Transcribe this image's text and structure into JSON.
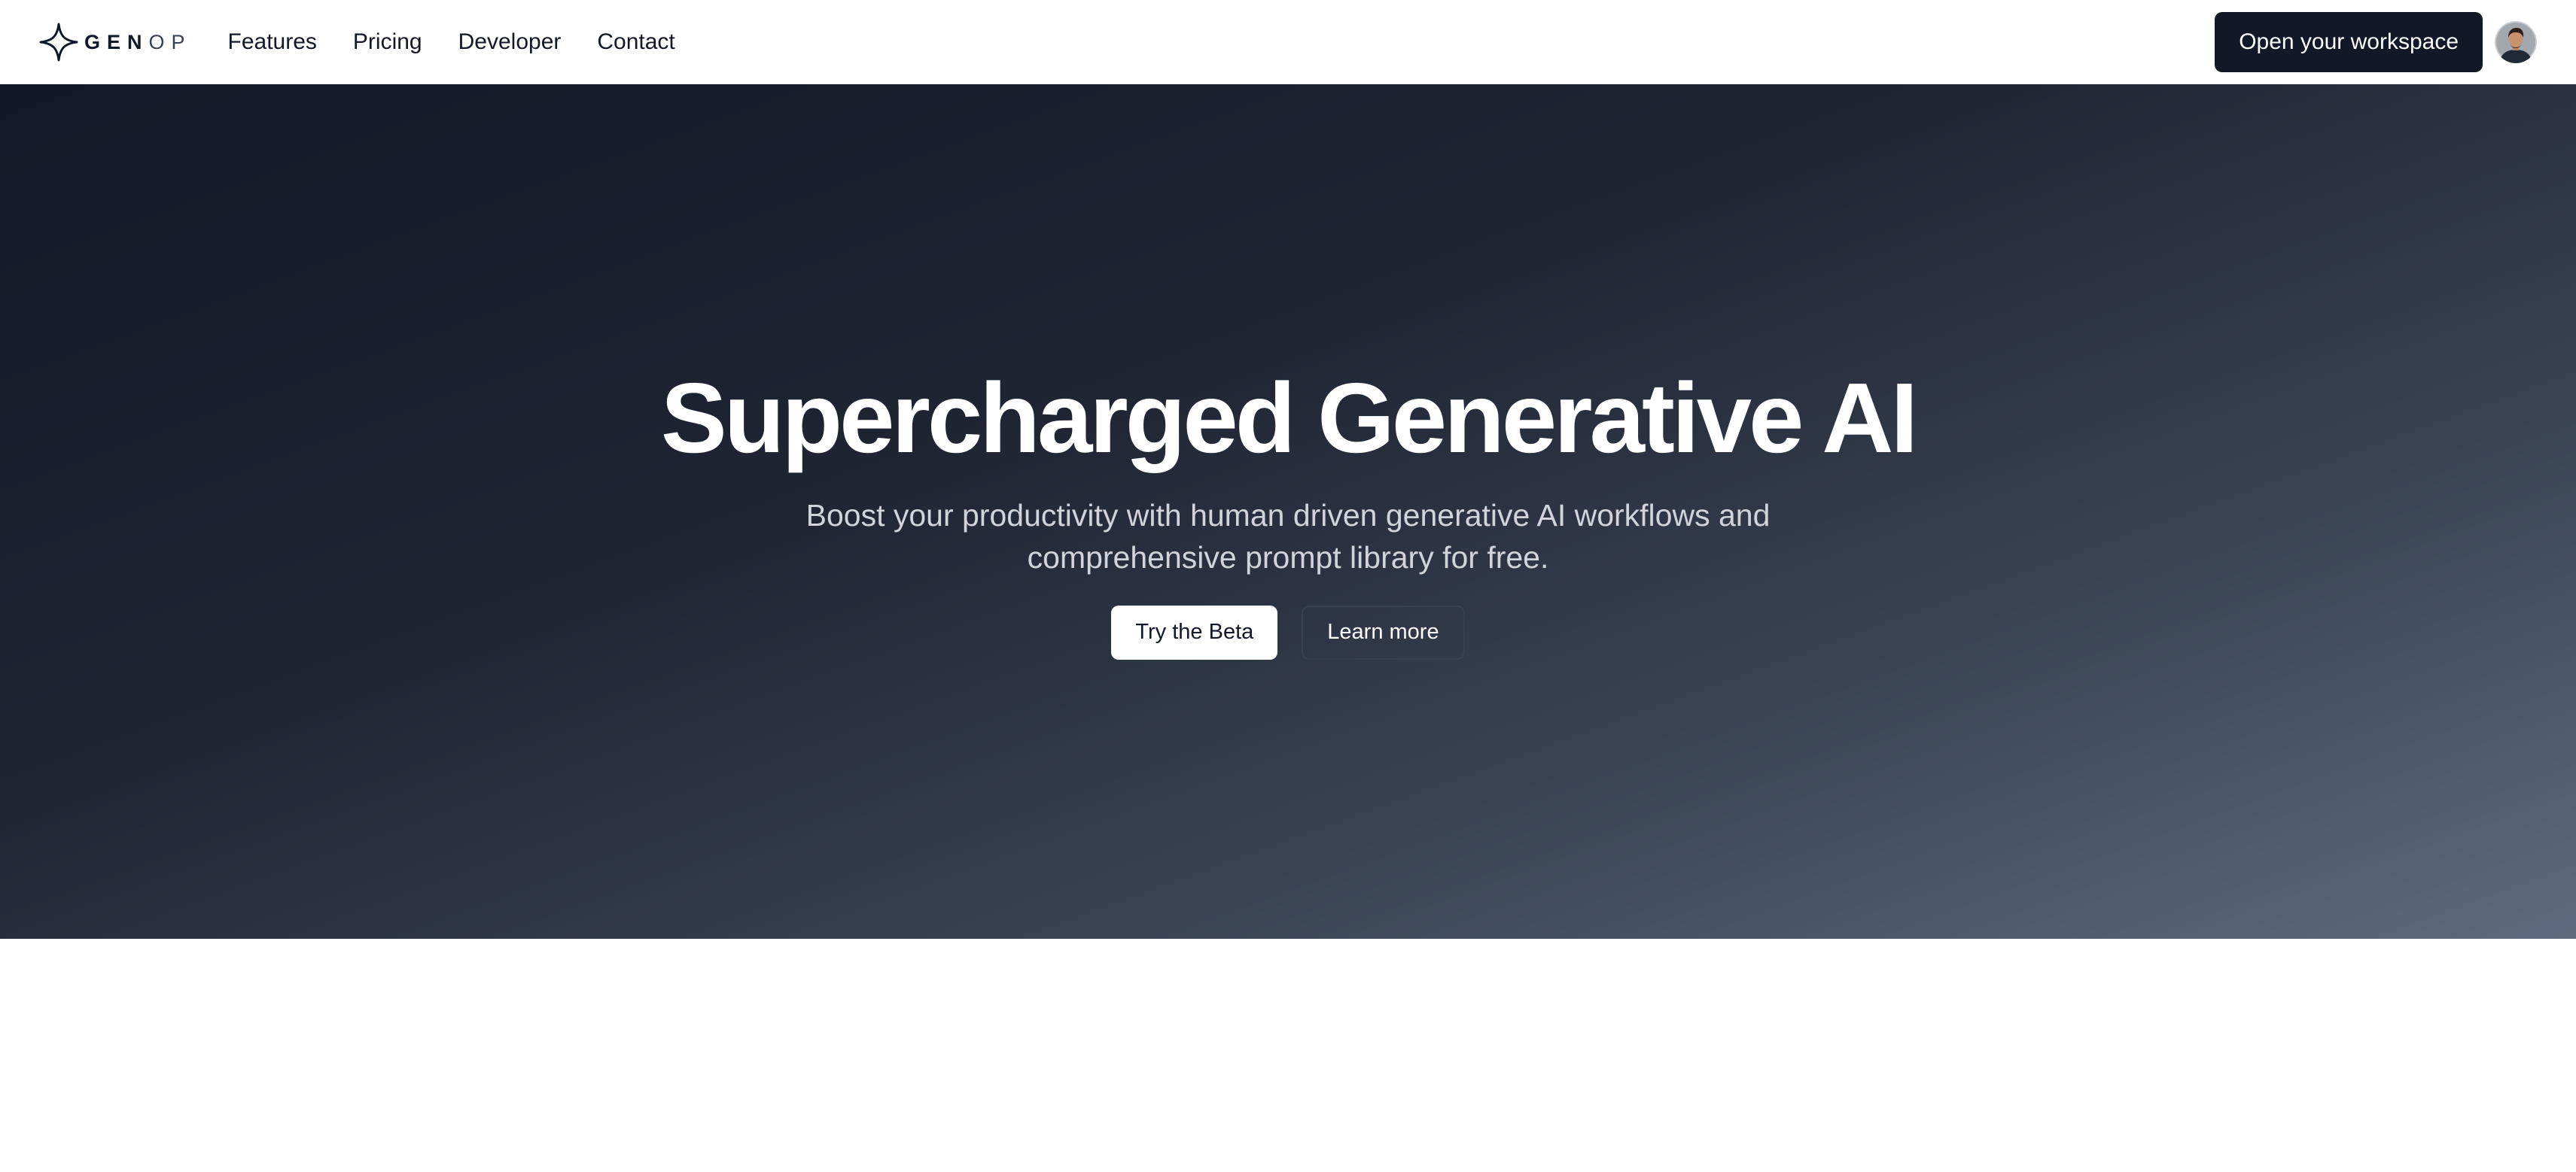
{
  "nav": {
    "logo_bold": "GEN",
    "logo_light": "OP",
    "links": [
      "Features",
      "Pricing",
      "Developer",
      "Contact"
    ],
    "workspace_button": "Open your workspace",
    "logo_icon": "sparkle-icon",
    "avatar": "user-avatar"
  },
  "hero": {
    "title": "Supercharged Generative AI",
    "subtitle": "Boost your productivity with human driven generative AI workflows and comprehensive prompt library for free.",
    "primary_button": "Try the Beta",
    "secondary_button": "Learn more"
  },
  "colors": {
    "brand_dark": "#111827",
    "hero_gradient_start": "#111827",
    "hero_gradient_end": "#5e6a7f",
    "subtitle_text": "#d1d5db"
  }
}
